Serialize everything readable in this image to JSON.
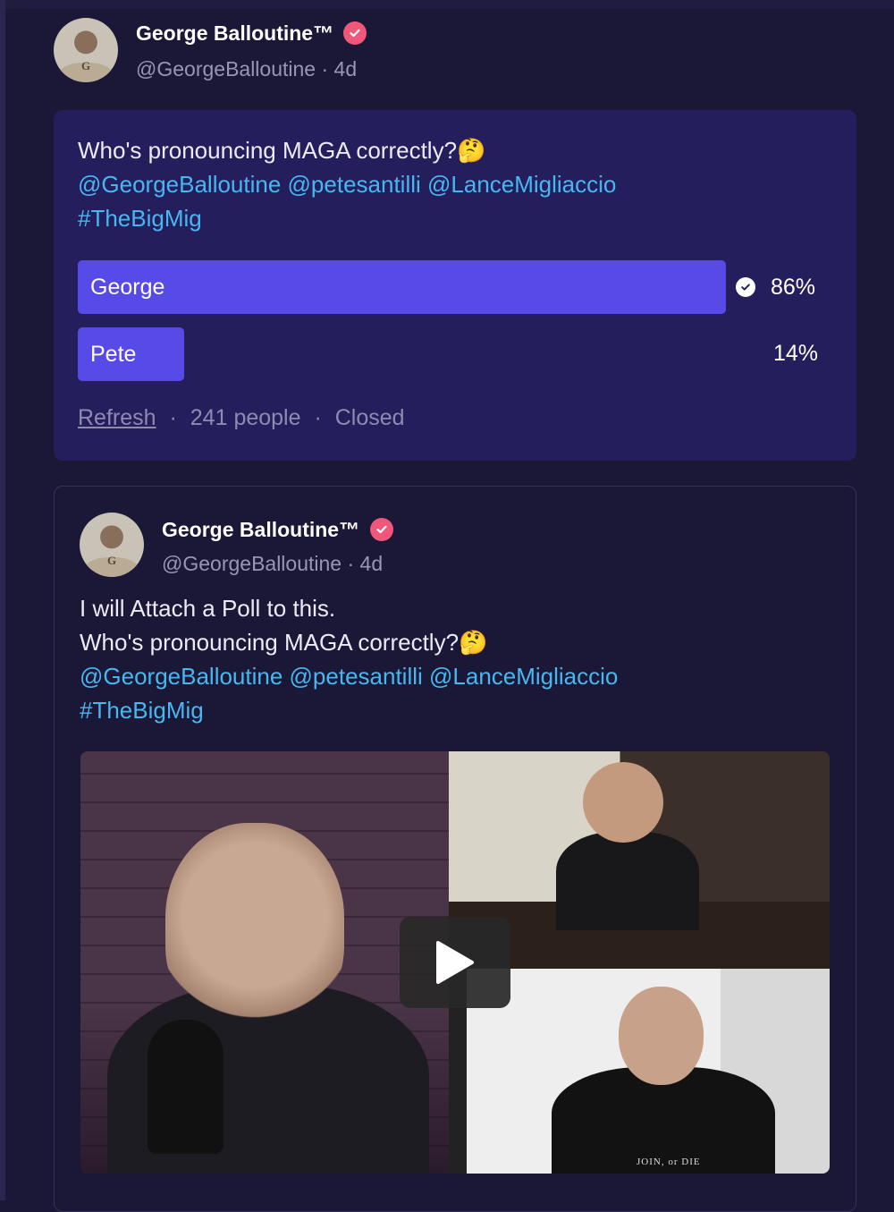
{
  "colors": {
    "background": "#1b1736",
    "poll_card": "#241f5c",
    "poll_bar": "#574ae6",
    "mention": "#48b6f0",
    "verified_badge": "#f0577a"
  },
  "poll_post": {
    "author": {
      "name": "George Balloutine™",
      "handle": "@GeorgeBalloutine",
      "time": "· 4d",
      "avatar_text": "G"
    },
    "question": "Who's pronouncing MAGA correctly?🤔",
    "mentions": "@GeorgeBalloutine @petesantilli @LanceMigliaccio",
    "hashtag": "#TheBigMig",
    "options": [
      {
        "label": "George",
        "percent": "86%",
        "fraction": 0.86,
        "selected": true,
        "icon": "check-circle-icon"
      },
      {
        "label": "Pete",
        "percent": "14%",
        "fraction": 0.14,
        "selected": false
      }
    ],
    "footer": {
      "refresh": "Refresh",
      "separator": "·",
      "people": "241 people",
      "status": "Closed"
    }
  },
  "quoted_post": {
    "author": {
      "name": "George Balloutine™",
      "handle": "@GeorgeBalloutine",
      "time": "· 4d",
      "avatar_text": "G"
    },
    "line1": "I will Attach a Poll to this.",
    "line2": "Who's pronouncing MAGA correctly?🤔",
    "mentions": "@GeorgeBalloutine @petesantilli @LanceMigliaccio",
    "hashtag": "#TheBigMig",
    "video": {
      "play_icon": "play-icon",
      "shirt_text": "JOIN, or DIE"
    }
  }
}
